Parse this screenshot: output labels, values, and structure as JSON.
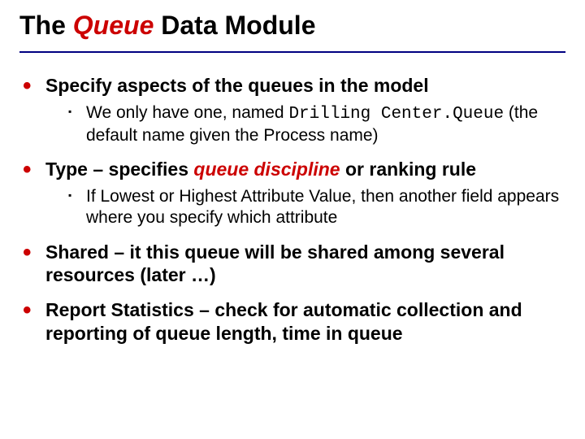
{
  "title": {
    "pre": "The ",
    "em": "Queue",
    "post": " Data Module"
  },
  "bullets": [
    {
      "text": "Specify aspects of the queues in the model",
      "sub": [
        {
          "pre": "We only have one, named ",
          "code": "Drilling Center.Queue",
          "post": " (the default name given the Process name)"
        }
      ]
    },
    {
      "pre": "Type – specifies ",
      "em": "queue discipline",
      "post": " or ranking rule",
      "sub": [
        {
          "text": "If Lowest or Highest Attribute Value, then another field appears where you specify which attribute"
        }
      ]
    },
    {
      "text": "Shared – it this queue will be shared among several resources (later …)"
    },
    {
      "text": "Report Statistics – check for automatic collection and reporting of queue length, time in queue"
    }
  ]
}
